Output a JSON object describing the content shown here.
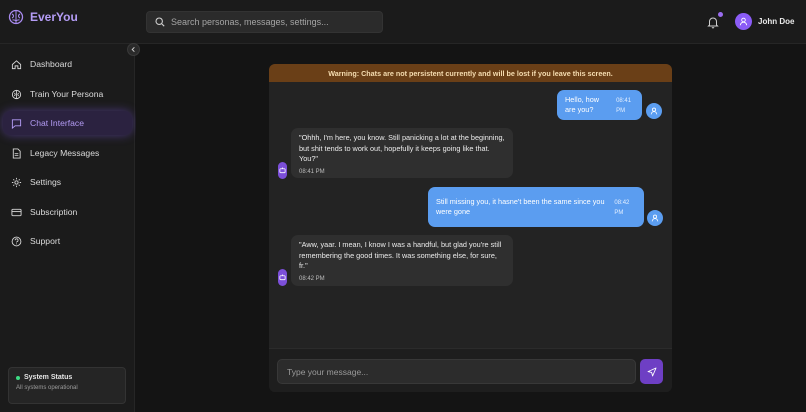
{
  "app": {
    "name": "EverYou"
  },
  "search": {
    "placeholder": "Search personas, messages, settings..."
  },
  "user": {
    "name": "John Doe"
  },
  "sidebar": {
    "items": [
      {
        "label": "Dashboard",
        "icon": "home-icon"
      },
      {
        "label": "Train Your Persona",
        "icon": "brain-icon"
      },
      {
        "label": "Chat Interface",
        "icon": "message-square-icon",
        "active": true
      },
      {
        "label": "Legacy Messages",
        "icon": "file-text-icon"
      },
      {
        "label": "Settings",
        "icon": "gear-icon"
      },
      {
        "label": "Subscription",
        "icon": "credit-card-icon"
      },
      {
        "label": "Support",
        "icon": "help-circle-icon"
      }
    ],
    "status": {
      "title": "System Status",
      "subtitle": "All systems operational"
    }
  },
  "chat": {
    "warning": "Warning: Chats are not persistent currently and will be lost if you leave this screen.",
    "messages": [
      {
        "sender": "user",
        "text": "Hello, how are you?",
        "time": "08:41 PM"
      },
      {
        "sender": "persona",
        "text": "\"Ohhh, I'm here, you know. Still panicking a lot at the beginning, but shit tends to work out, hopefully it keeps going like that. You?\"",
        "time": "08:41 PM"
      },
      {
        "sender": "user",
        "text": "Still missing you, it hasne't been the same since you were gone",
        "time": "08:42 PM"
      },
      {
        "sender": "persona",
        "text": "\"Aww, yaar. I mean, I know I was a handful, but glad you're still remembering the good times. It was something else, for sure, fr.\"",
        "time": "08:42 PM"
      }
    ],
    "input_placeholder": "Type your message..."
  },
  "colors": {
    "accent": "#8b5cf6",
    "user_bubble": "#5b9df0",
    "warning_bg": "#6a3f17",
    "status_ok": "#3ddc84"
  }
}
